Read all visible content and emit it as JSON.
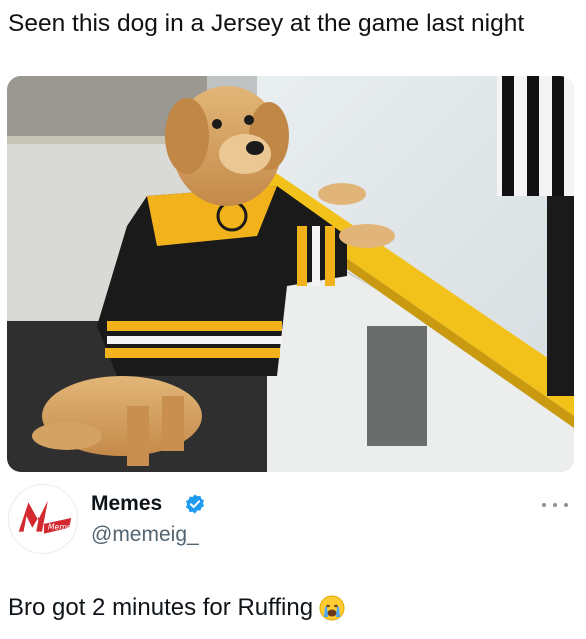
{
  "caption": "Seen this dog in a Jersey at the game last night",
  "image": {
    "icon": "dog-in-hockey-jersey-photo"
  },
  "post": {
    "author": {
      "display_name": "Memes",
      "handle": "@memeig_",
      "verified": true,
      "avatar_text": "Memes"
    },
    "text": "Bro got 2 minutes for Ruffing",
    "emoji": "crying-face-emoji"
  },
  "colors": {
    "accent_verified": "#1d9bf0",
    "rink_yellow": "#f2c21b",
    "jersey_black": "#1a1a1a",
    "handle_gray": "#536471",
    "avatar_red": "#d32a2f"
  }
}
